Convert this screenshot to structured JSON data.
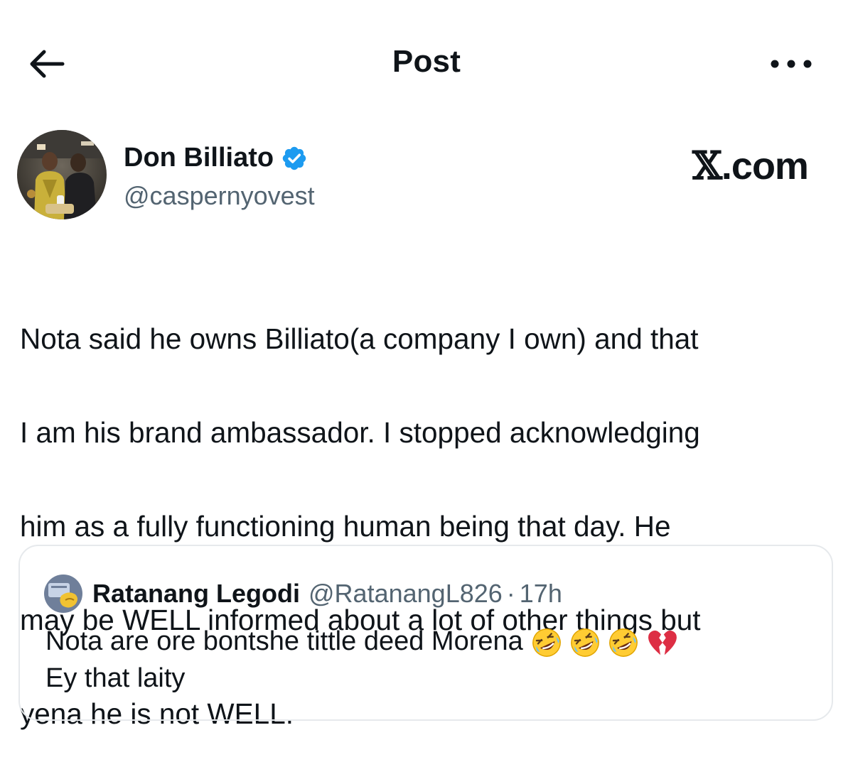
{
  "header": {
    "title": "Post",
    "back_icon": "arrow-left-icon",
    "more_icon": "more-horizontal-icon"
  },
  "post": {
    "author": {
      "display_name": "Don Billiato",
      "handle": "@caspernyovest",
      "verified": true,
      "verified_color": "#1d9bf0"
    },
    "brand_prefix": "𝕏",
    "brand_suffix": ".com",
    "text_lines": [
      "Nota said he owns Billiato(a company I own) and that",
      "I am his brand ambassador. I stopped acknowledging",
      "him as a fully functioning human being that day. He",
      "may be WELL informed about a lot of other things but",
      "yena he is not WELL."
    ]
  },
  "quote": {
    "display_name": "Ratanang Legodi",
    "handle": "@RatanangL826",
    "separator": "·",
    "time": "17h",
    "line1": "Nota are ore bontshe tittle deed Morena",
    "emojis": [
      "rofl-emoji",
      "rofl-emoji",
      "rofl-emoji",
      "broken-heart-emoji"
    ],
    "line2": "Ey that laity"
  },
  "colors": {
    "text_primary": "#0f1419",
    "text_secondary": "#536471",
    "border": "#e6e9ec",
    "accent": "#1d9bf0"
  }
}
